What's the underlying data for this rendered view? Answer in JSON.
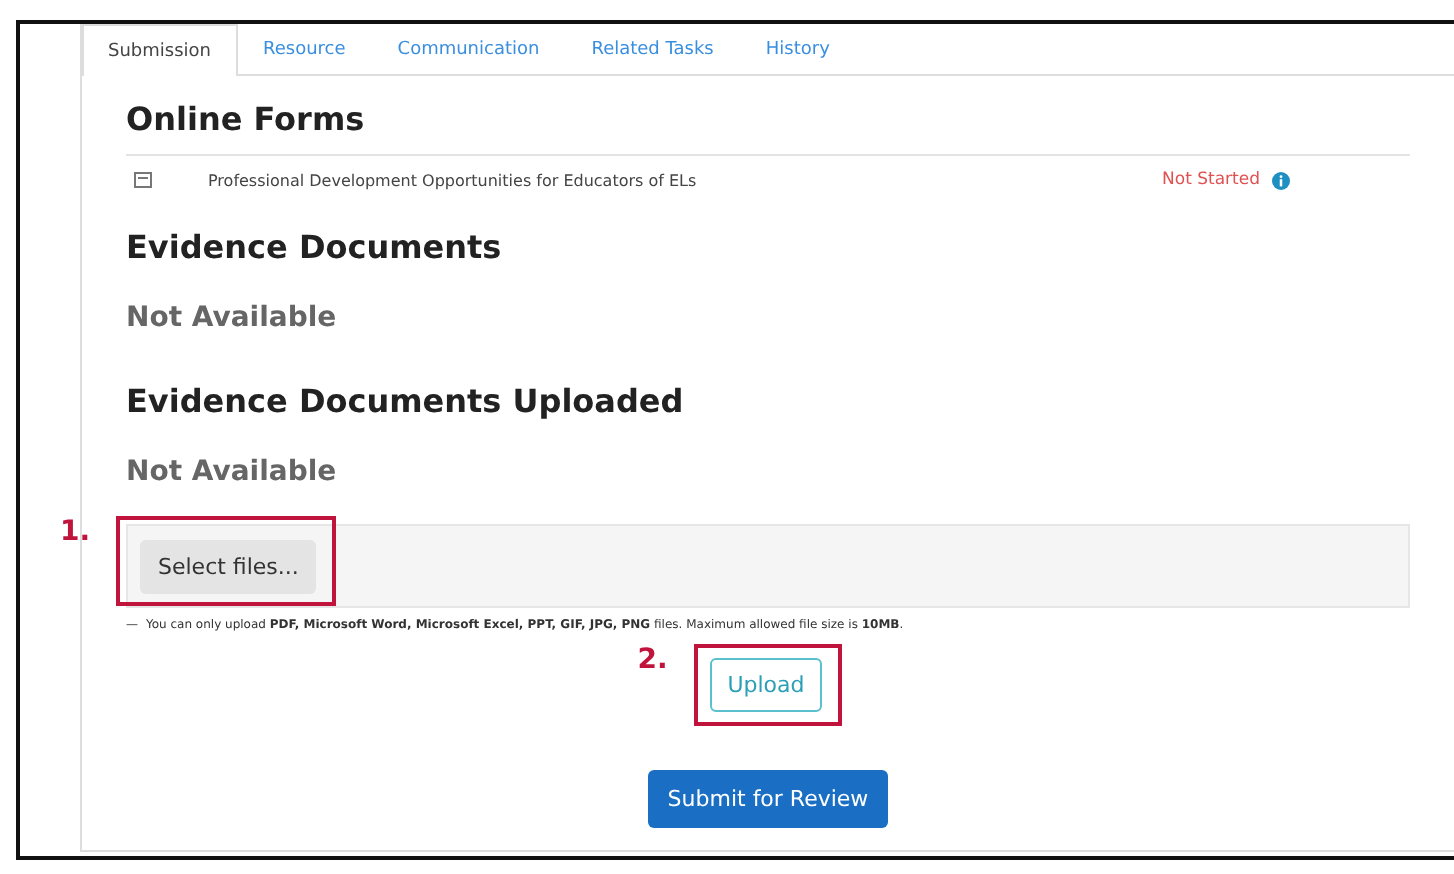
{
  "tabs": [
    {
      "label": "Submission",
      "selected": true
    },
    {
      "label": "Resource",
      "selected": false
    },
    {
      "label": "Communication",
      "selected": false
    },
    {
      "label": "Related Tasks",
      "selected": false
    },
    {
      "label": "History",
      "selected": false
    }
  ],
  "online_forms": {
    "title": "Online Forms",
    "items": [
      {
        "name": "Professional Development Opportunities for Educators of ELs",
        "status": "Not Started"
      }
    ]
  },
  "evidence_documents": {
    "title": "Evidence Documents",
    "empty_text": "Not Available"
  },
  "evidence_uploaded": {
    "title": "Evidence Documents Uploaded",
    "empty_text": "Not Available"
  },
  "upload": {
    "hint_marker": "—",
    "select_button": "Select files...",
    "select_annotation": "1.",
    "hint": "You can only upload **PDF, Microsoft Word, Microsoft Excel, PPT, GIF, JPG, PNG** files. Maximum allowed file size is **10MB**.",
    "upload_button": "Upload",
    "upload_annotation": "2."
  },
  "submit_button": "Submit for Review"
}
